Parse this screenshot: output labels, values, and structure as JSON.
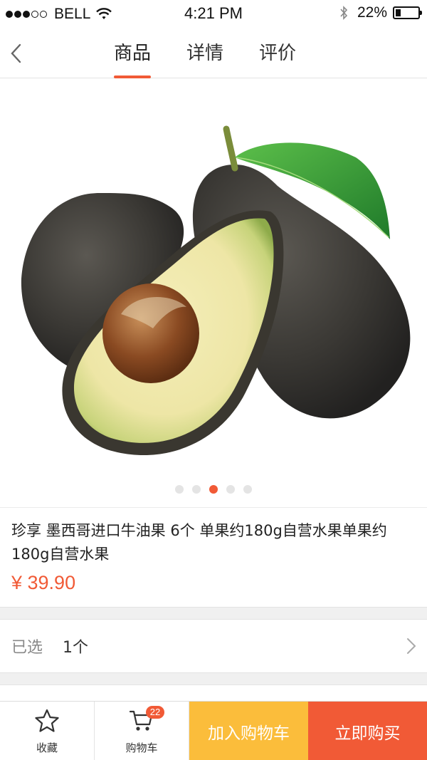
{
  "status_bar": {
    "carrier": "BELL",
    "time": "4:21 PM",
    "battery_percent": "22%",
    "battery_level": 0.22,
    "signal_strength": 3,
    "signal_max": 5
  },
  "nav": {
    "tabs": [
      {
        "label": "商品",
        "active": true
      },
      {
        "label": "详情",
        "active": false
      },
      {
        "label": "评价",
        "active": false
      }
    ]
  },
  "gallery": {
    "page_count": 5,
    "current_page": 3
  },
  "product": {
    "title": "珍享 墨西哥进口牛油果 6个 单果约180g自营水果单果约180g自营水果",
    "price": "¥ 39.90"
  },
  "selection": {
    "label": "已选",
    "value": "1个"
  },
  "bottom_bar": {
    "favorite_label": "收藏",
    "cart_label": "购物车",
    "cart_badge": "22",
    "add_to_cart_label": "加入购物车",
    "buy_now_label": "立即购买"
  },
  "colors": {
    "accent": "#f15a36",
    "add_to_cart_bg": "#fbbd3b"
  },
  "icons": [
    "back-chevron-icon",
    "star-icon",
    "cart-icon",
    "chevron-right-icon",
    "wifi-icon",
    "bluetooth-icon",
    "battery-icon"
  ]
}
